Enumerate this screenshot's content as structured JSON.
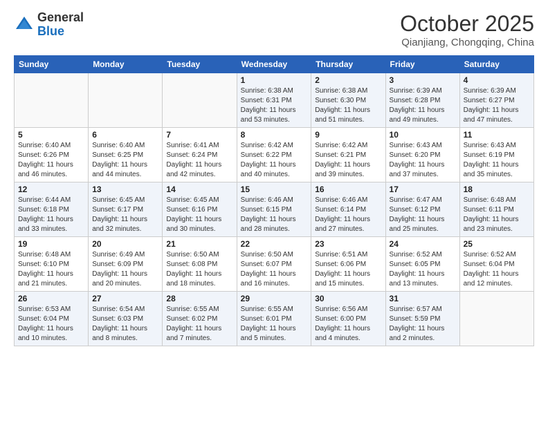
{
  "header": {
    "logo_general": "General",
    "logo_blue": "Blue",
    "month": "October 2025",
    "location": "Qianjiang, Chongqing, China"
  },
  "days_of_week": [
    "Sunday",
    "Monday",
    "Tuesday",
    "Wednesday",
    "Thursday",
    "Friday",
    "Saturday"
  ],
  "weeks": [
    [
      {
        "day": "",
        "info": ""
      },
      {
        "day": "",
        "info": ""
      },
      {
        "day": "",
        "info": ""
      },
      {
        "day": "1",
        "info": "Sunrise: 6:38 AM\nSunset: 6:31 PM\nDaylight: 11 hours and 53 minutes."
      },
      {
        "day": "2",
        "info": "Sunrise: 6:38 AM\nSunset: 6:30 PM\nDaylight: 11 hours and 51 minutes."
      },
      {
        "day": "3",
        "info": "Sunrise: 6:39 AM\nSunset: 6:28 PM\nDaylight: 11 hours and 49 minutes."
      },
      {
        "day": "4",
        "info": "Sunrise: 6:39 AM\nSunset: 6:27 PM\nDaylight: 11 hours and 47 minutes."
      }
    ],
    [
      {
        "day": "5",
        "info": "Sunrise: 6:40 AM\nSunset: 6:26 PM\nDaylight: 11 hours and 46 minutes."
      },
      {
        "day": "6",
        "info": "Sunrise: 6:40 AM\nSunset: 6:25 PM\nDaylight: 11 hours and 44 minutes."
      },
      {
        "day": "7",
        "info": "Sunrise: 6:41 AM\nSunset: 6:24 PM\nDaylight: 11 hours and 42 minutes."
      },
      {
        "day": "8",
        "info": "Sunrise: 6:42 AM\nSunset: 6:22 PM\nDaylight: 11 hours and 40 minutes."
      },
      {
        "day": "9",
        "info": "Sunrise: 6:42 AM\nSunset: 6:21 PM\nDaylight: 11 hours and 39 minutes."
      },
      {
        "day": "10",
        "info": "Sunrise: 6:43 AM\nSunset: 6:20 PM\nDaylight: 11 hours and 37 minutes."
      },
      {
        "day": "11",
        "info": "Sunrise: 6:43 AM\nSunset: 6:19 PM\nDaylight: 11 hours and 35 minutes."
      }
    ],
    [
      {
        "day": "12",
        "info": "Sunrise: 6:44 AM\nSunset: 6:18 PM\nDaylight: 11 hours and 33 minutes."
      },
      {
        "day": "13",
        "info": "Sunrise: 6:45 AM\nSunset: 6:17 PM\nDaylight: 11 hours and 32 minutes."
      },
      {
        "day": "14",
        "info": "Sunrise: 6:45 AM\nSunset: 6:16 PM\nDaylight: 11 hours and 30 minutes."
      },
      {
        "day": "15",
        "info": "Sunrise: 6:46 AM\nSunset: 6:15 PM\nDaylight: 11 hours and 28 minutes."
      },
      {
        "day": "16",
        "info": "Sunrise: 6:46 AM\nSunset: 6:14 PM\nDaylight: 11 hours and 27 minutes."
      },
      {
        "day": "17",
        "info": "Sunrise: 6:47 AM\nSunset: 6:12 PM\nDaylight: 11 hours and 25 minutes."
      },
      {
        "day": "18",
        "info": "Sunrise: 6:48 AM\nSunset: 6:11 PM\nDaylight: 11 hours and 23 minutes."
      }
    ],
    [
      {
        "day": "19",
        "info": "Sunrise: 6:48 AM\nSunset: 6:10 PM\nDaylight: 11 hours and 21 minutes."
      },
      {
        "day": "20",
        "info": "Sunrise: 6:49 AM\nSunset: 6:09 PM\nDaylight: 11 hours and 20 minutes."
      },
      {
        "day": "21",
        "info": "Sunrise: 6:50 AM\nSunset: 6:08 PM\nDaylight: 11 hours and 18 minutes."
      },
      {
        "day": "22",
        "info": "Sunrise: 6:50 AM\nSunset: 6:07 PM\nDaylight: 11 hours and 16 minutes."
      },
      {
        "day": "23",
        "info": "Sunrise: 6:51 AM\nSunset: 6:06 PM\nDaylight: 11 hours and 15 minutes."
      },
      {
        "day": "24",
        "info": "Sunrise: 6:52 AM\nSunset: 6:05 PM\nDaylight: 11 hours and 13 minutes."
      },
      {
        "day": "25",
        "info": "Sunrise: 6:52 AM\nSunset: 6:04 PM\nDaylight: 11 hours and 12 minutes."
      }
    ],
    [
      {
        "day": "26",
        "info": "Sunrise: 6:53 AM\nSunset: 6:04 PM\nDaylight: 11 hours and 10 minutes."
      },
      {
        "day": "27",
        "info": "Sunrise: 6:54 AM\nSunset: 6:03 PM\nDaylight: 11 hours and 8 minutes."
      },
      {
        "day": "28",
        "info": "Sunrise: 6:55 AM\nSunset: 6:02 PM\nDaylight: 11 hours and 7 minutes."
      },
      {
        "day": "29",
        "info": "Sunrise: 6:55 AM\nSunset: 6:01 PM\nDaylight: 11 hours and 5 minutes."
      },
      {
        "day": "30",
        "info": "Sunrise: 6:56 AM\nSunset: 6:00 PM\nDaylight: 11 hours and 4 minutes."
      },
      {
        "day": "31",
        "info": "Sunrise: 6:57 AM\nSunset: 5:59 PM\nDaylight: 11 hours and 2 minutes."
      },
      {
        "day": "",
        "info": ""
      }
    ]
  ]
}
